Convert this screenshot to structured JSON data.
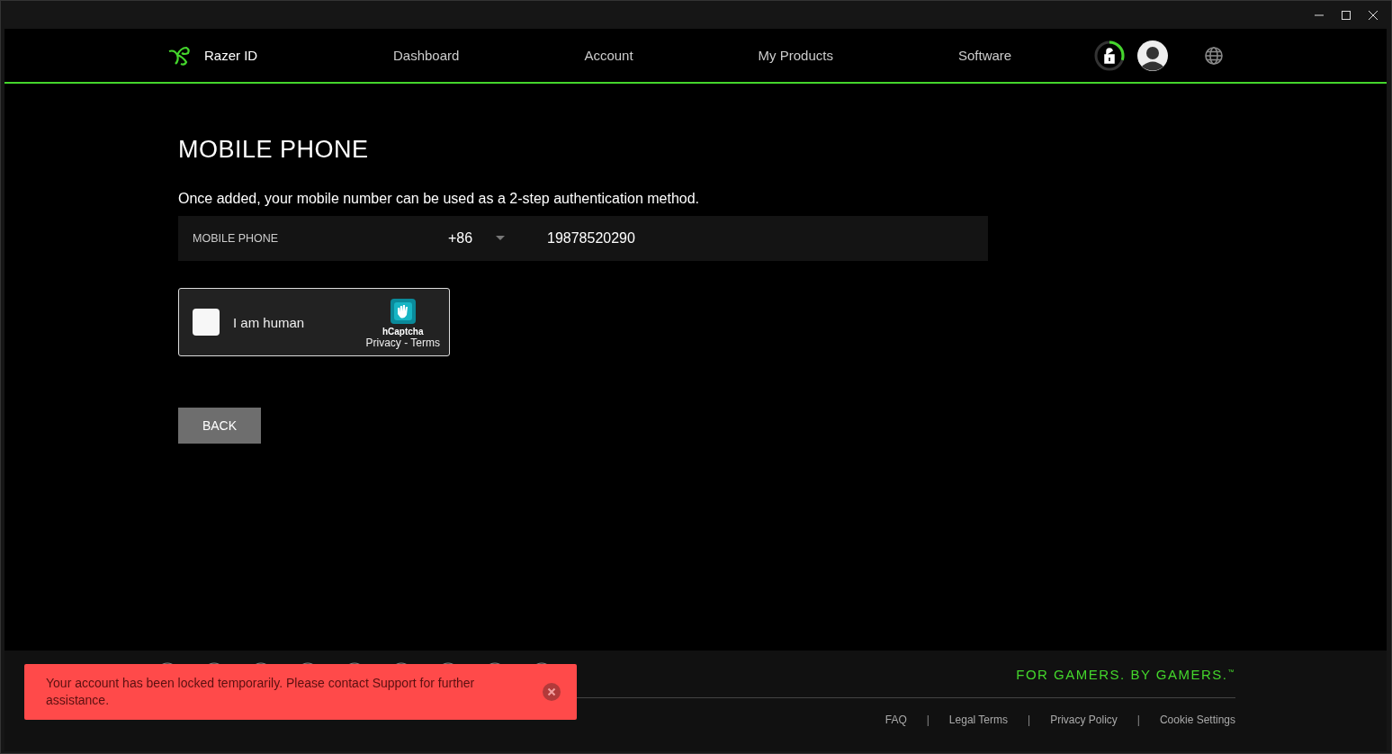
{
  "nav": {
    "brand": "Razer ID",
    "links": [
      {
        "label": "Dashboard",
        "selected": false
      },
      {
        "label": "Account",
        "selected": false
      },
      {
        "label": "My Products",
        "selected": false
      },
      {
        "label": "Software",
        "selected": false
      }
    ],
    "lock_timer": {
      "level": 0.3
    }
  },
  "page": {
    "title": "MOBILE PHONE",
    "description": "Once added, your mobile number can be used as a 2-step authentication method.",
    "phone_field": {
      "label": "MOBILE PHONE",
      "country_code": "+86",
      "value": "19878520290"
    },
    "captcha": {
      "label": "I am human",
      "checked": false,
      "brand": "hCaptcha",
      "privacy": "Privacy",
      "separator": "-",
      "terms": "Terms"
    },
    "back_button": "BACK"
  },
  "footer": {
    "social_icons": [
      {
        "kind": "circle"
      },
      {
        "kind": "circle"
      },
      {
        "kind": "circle"
      },
      {
        "kind": "circle"
      },
      {
        "kind": "circle"
      },
      {
        "kind": "circle"
      },
      {
        "kind": "circle"
      },
      {
        "kind": "circle"
      },
      {
        "kind": "circle"
      }
    ],
    "slogan": "FOR GAMERS. BY GAMERS.",
    "slogan_mark": "™",
    "links": [
      {
        "kind": "link",
        "label": "FAQ"
      },
      {
        "kind": "separator",
        "label": "|"
      },
      {
        "kind": "link",
        "label": "Legal Terms"
      },
      {
        "kind": "separator",
        "label": "|"
      },
      {
        "kind": "link",
        "label": "Privacy Policy"
      },
      {
        "kind": "separator",
        "label": "|"
      },
      {
        "kind": "link",
        "label": "Cookie Settings"
      }
    ]
  },
  "toast": {
    "message": "Your account has been locked temporarily. Please contact Support for further assistance."
  }
}
